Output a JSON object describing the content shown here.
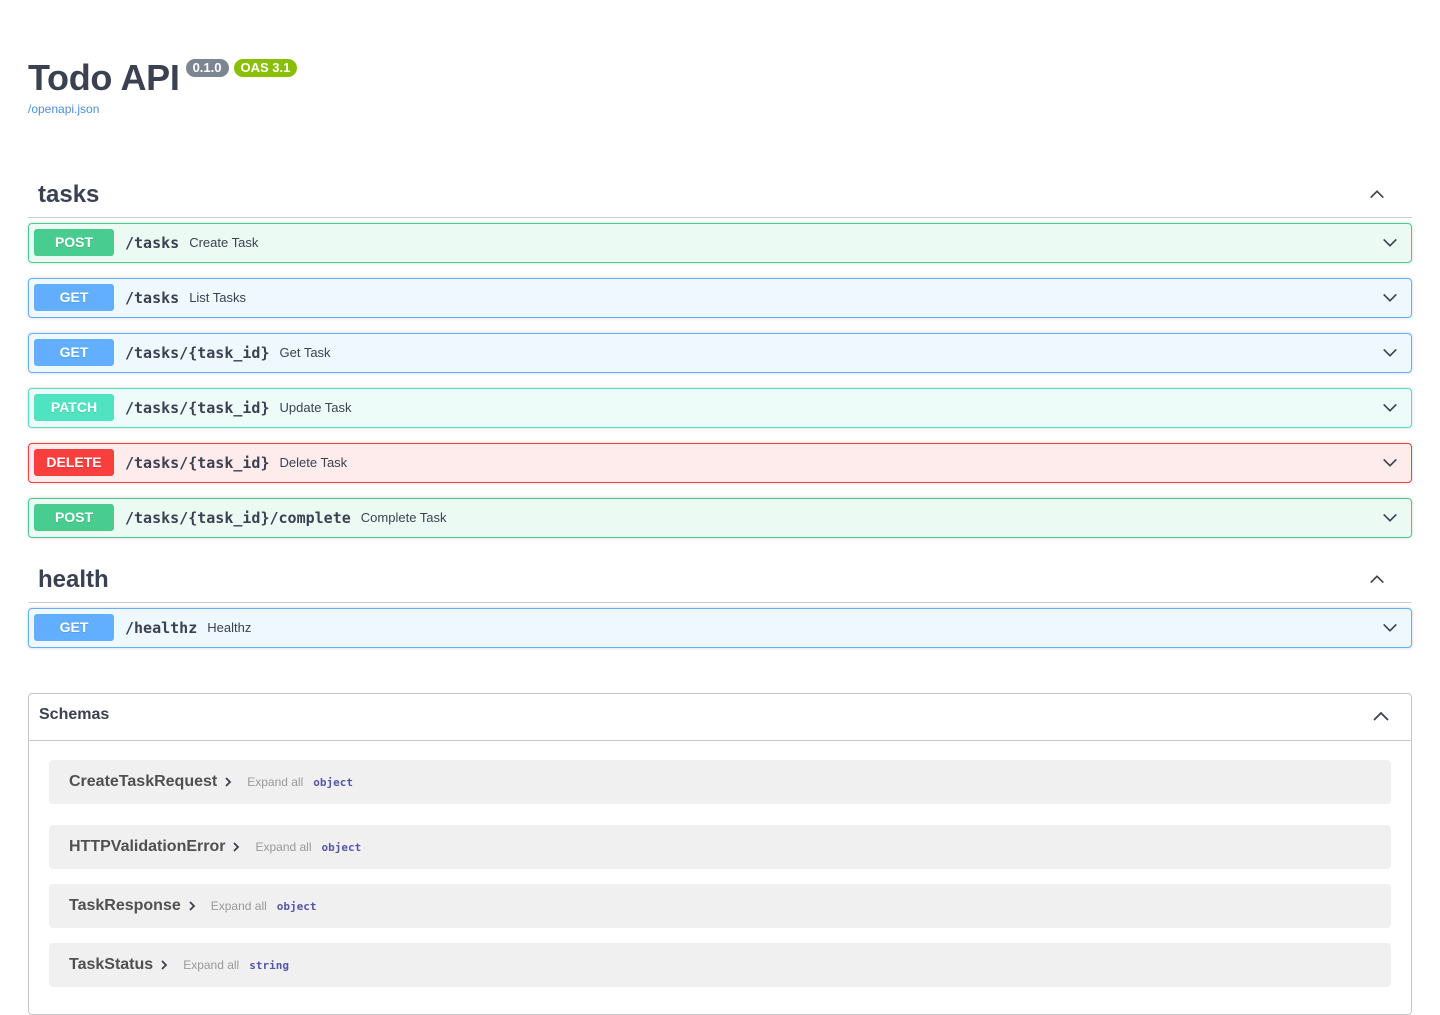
{
  "info": {
    "title": "Todo API",
    "version": "0.1.0",
    "oas": "OAS 3.1",
    "spec_link": "/openapi.json"
  },
  "tags": [
    {
      "name": "tasks"
    },
    {
      "name": "health"
    }
  ],
  "operations": [
    {
      "method": "POST",
      "path": "/tasks",
      "summary": "Create Task"
    },
    {
      "method": "GET",
      "path": "/tasks",
      "summary": "List Tasks"
    },
    {
      "method": "GET",
      "path": "/tasks/{task_id}",
      "summary": "Get Task"
    },
    {
      "method": "PATCH",
      "path": "/tasks/{task_id}",
      "summary": "Update Task"
    },
    {
      "method": "DELETE",
      "path": "/tasks/{task_id}",
      "summary": "Delete Task"
    },
    {
      "method": "POST",
      "path": "/tasks/{task_id}/complete",
      "summary": "Complete Task"
    },
    {
      "method": "GET",
      "path": "/healthz",
      "summary": "Healthz"
    }
  ],
  "schemas": {
    "title": "Schemas",
    "items": [
      {
        "name": "CreateTaskRequest",
        "expand": "Expand all",
        "type": "object"
      },
      {
        "name": "HTTPValidationError",
        "expand": "Expand all",
        "type": "object"
      },
      {
        "name": "TaskResponse",
        "expand": "Expand all",
        "type": "object"
      },
      {
        "name": "TaskStatus",
        "expand": "Expand all",
        "type": "string"
      }
    ]
  },
  "colors": {
    "post": "#49cc90",
    "get": "#61affe",
    "patch": "#50e3c2",
    "delete": "#f93e3e",
    "version_badge": "#7d8492",
    "oas_badge": "#89bf04",
    "link": "#4990e2"
  },
  "icons": {
    "tag_toggle": "chevron-up-icon",
    "operation_toggle": "chevron-down-icon",
    "schema_toggle": "chevron-right-icon"
  }
}
